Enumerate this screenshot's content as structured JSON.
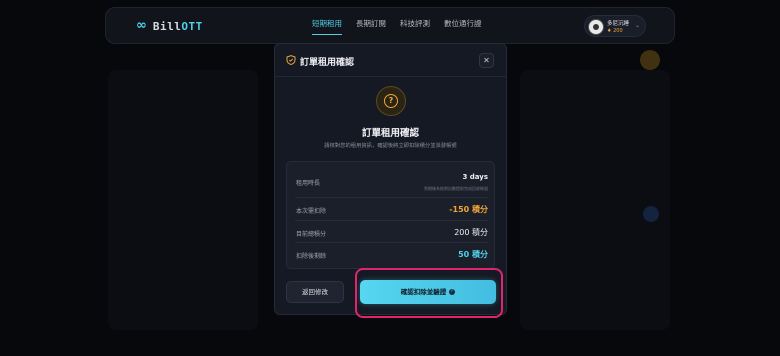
{
  "navbar": {
    "logo_symbol": "∞",
    "logo_text": "Bill",
    "logo_text_accent": "OTT",
    "items": [
      {
        "label": "短期租用",
        "active": true
      },
      {
        "label": "長期訂閱",
        "active": false
      },
      {
        "label": "科技評測",
        "active": false
      },
      {
        "label": "數位通行證",
        "active": false
      }
    ],
    "user": {
      "name": "多尼沉睡",
      "points": "200",
      "points_icon": "diamond-icon"
    }
  },
  "modal": {
    "header_title": "訂單租用確認",
    "header_icon": "shield-icon",
    "close_label": "✕",
    "question_icon": "?",
    "title": "訂單租用確認",
    "description": "請核對您的租用資訊，確認後將立即扣除積分並派發帳號",
    "details": [
      {
        "label": "租用時長",
        "value": "3 days",
        "sub": "到期後系統將自動提前完成回收帳號"
      },
      {
        "label": "本次需扣除",
        "value": "-150 積分"
      },
      {
        "label": "目前總積分",
        "value": "200 積分"
      },
      {
        "label": "扣除後剩餘",
        "value": "50 積分"
      }
    ],
    "back_button": "返回修改",
    "confirm_button": "確認扣除並驗證",
    "confirm_icon": "check-circle-icon"
  },
  "colors": {
    "accent": "#4fd1e8",
    "warning": "#f0a53a",
    "highlight": "#e0246e",
    "background": "#07080c"
  }
}
